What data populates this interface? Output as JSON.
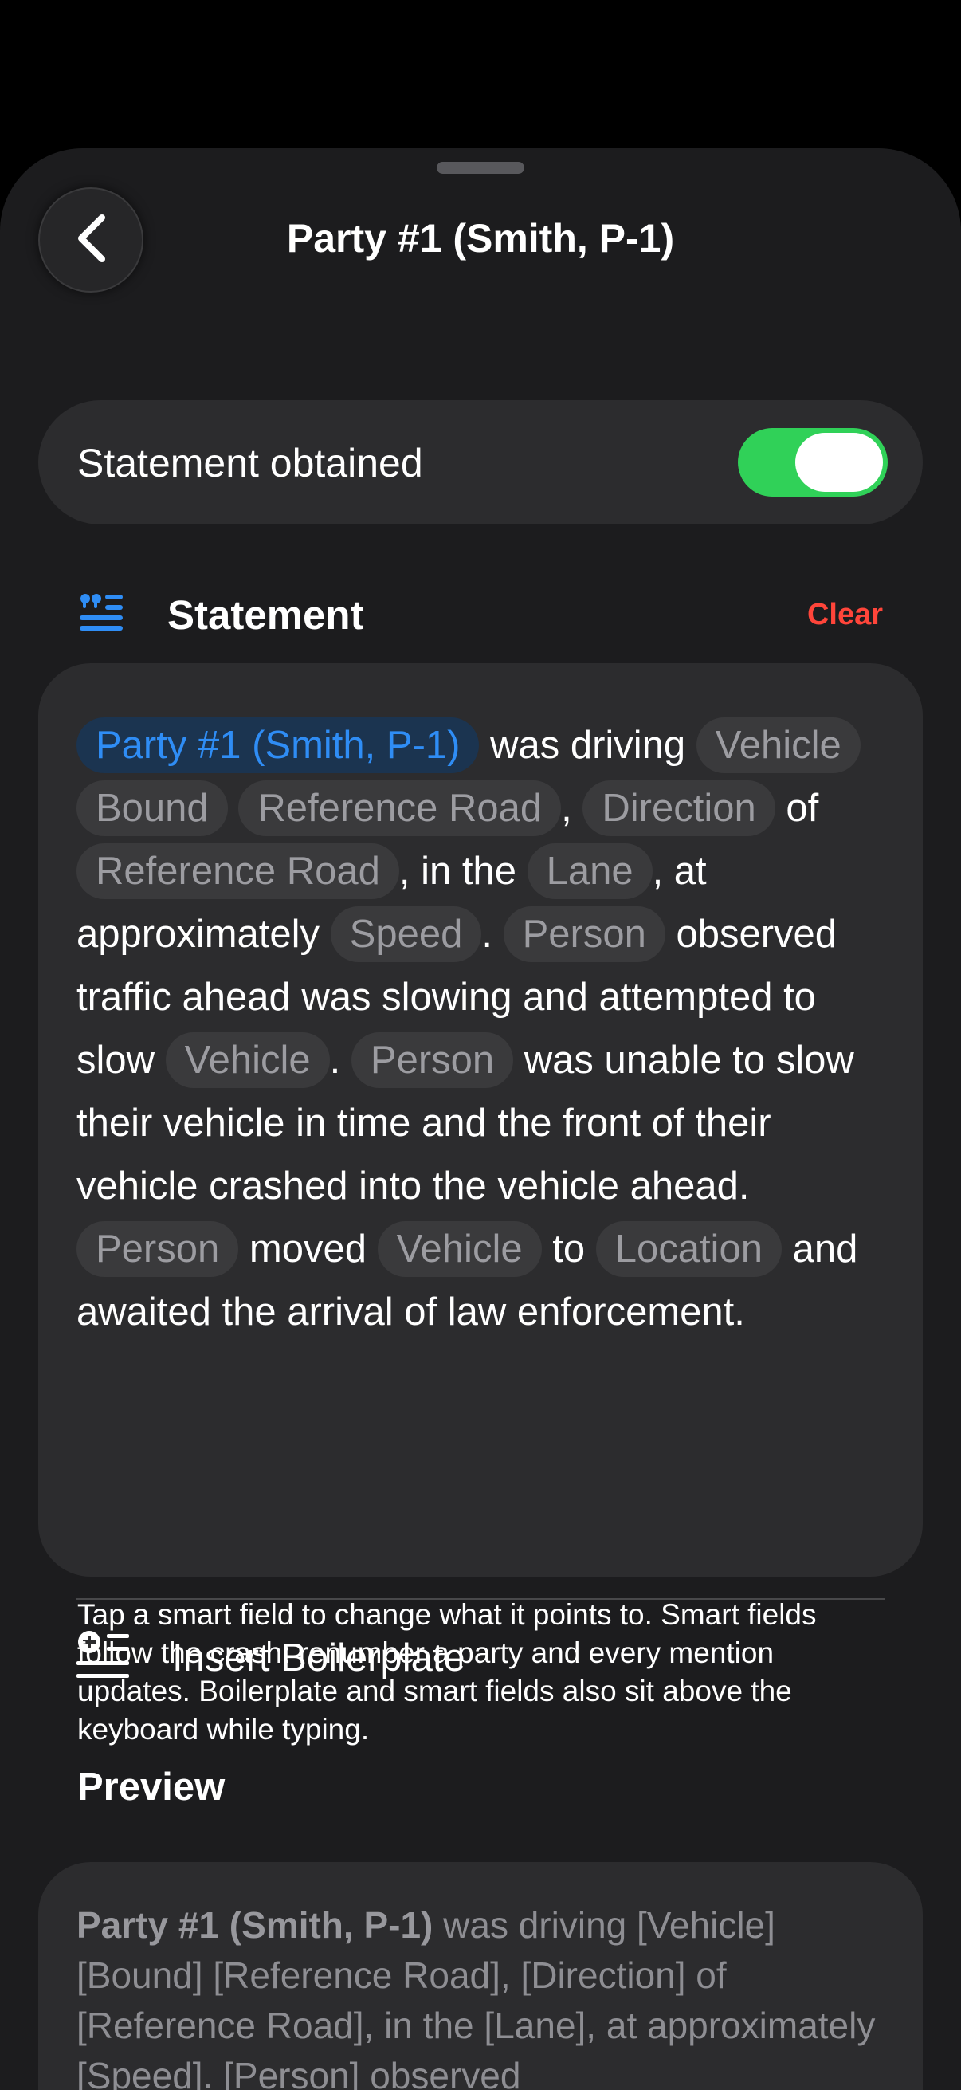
{
  "header": {
    "title": "Party #1 (Smith, P-1)",
    "back_icon": "chevron-left-icon"
  },
  "toggle": {
    "label": "Statement obtained",
    "on": true,
    "color": "#30d158"
  },
  "statement_section": {
    "icon": "quote-lines-icon",
    "title": "Statement",
    "clear_label": "Clear",
    "clear_color": "#ff453a"
  },
  "statement": {
    "segments": [
      {
        "type": "party",
        "text": "Party #1 (Smith, P-1)"
      },
      {
        "type": "text",
        "text": " was driving "
      },
      {
        "type": "chip",
        "text": "Vehicle"
      },
      {
        "type": "text",
        "text": " "
      },
      {
        "type": "chip",
        "text": "Bound"
      },
      {
        "type": "text",
        "text": " "
      },
      {
        "type": "chip",
        "text": "Reference Road"
      },
      {
        "type": "text",
        "text": ", "
      },
      {
        "type": "chip",
        "text": "Direction"
      },
      {
        "type": "text",
        "text": " of "
      },
      {
        "type": "chip",
        "text": "Reference Road"
      },
      {
        "type": "text",
        "text": ", in the "
      },
      {
        "type": "chip",
        "text": "Lane"
      },
      {
        "type": "text",
        "text": ", at approximately "
      },
      {
        "type": "chip",
        "text": "Speed"
      },
      {
        "type": "text",
        "text": ". "
      },
      {
        "type": "chip",
        "text": "Person"
      },
      {
        "type": "text",
        "text": " observed traffic ahead was slowing and attempted to slow "
      },
      {
        "type": "chip",
        "text": "Vehicle"
      },
      {
        "type": "text",
        "text": ". "
      },
      {
        "type": "chip",
        "text": "Person"
      },
      {
        "type": "text",
        "text": " was unable to slow their vehicle in time and the front of their vehicle crashed into the vehicle ahead. "
      },
      {
        "type": "chip",
        "text": "Person"
      },
      {
        "type": "text",
        "text": " moved "
      },
      {
        "type": "chip",
        "text": "Vehicle"
      },
      {
        "type": "text",
        "text": " to "
      },
      {
        "type": "chip",
        "text": "Location"
      },
      {
        "type": "text",
        "text": " and awaited the arrival of law enforcement."
      }
    ],
    "party_chip_color": "#2f8df5"
  },
  "boilerplate": {
    "icon": "add-list-icon",
    "label": "Insert Boilerplate"
  },
  "helper_text": "Tap a smart field to change what it points to. Smart fields follow the crash: renumber a party and every mention updates. Boilerplate and smart fields also sit above the keyboard while typing.",
  "preview": {
    "heading": "Preview",
    "bold_lead": "Party #1 (Smith, P-1)",
    "rest": " was driving [Vehicle] [Bound] [Reference Road], [Direction] of [Reference Road], in the [Lane], at approximately [Speed]. [Person] observed"
  }
}
